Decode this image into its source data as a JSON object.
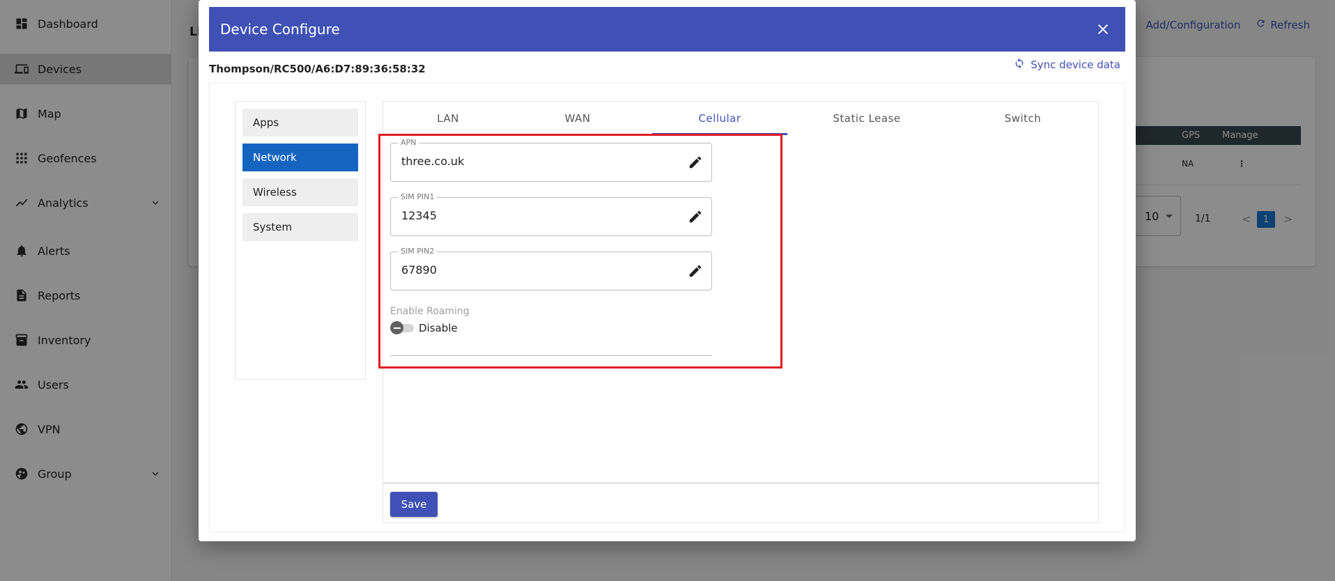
{
  "sidebar": {
    "items": [
      {
        "label": "Dashboard",
        "icon": "dashboard-icon"
      },
      {
        "label": "Devices",
        "icon": "devices-icon",
        "active": true
      },
      {
        "label": "Map",
        "icon": "map-icon"
      },
      {
        "label": "Geofences",
        "icon": "geofence-icon"
      },
      {
        "label": "Analytics",
        "icon": "analytics-icon",
        "expandable": true
      },
      {
        "label": "Alerts",
        "icon": "bell-icon"
      },
      {
        "label": "Reports",
        "icon": "report-icon"
      },
      {
        "label": "Inventory",
        "icon": "inventory-icon"
      },
      {
        "label": "Users",
        "icon": "users-icon"
      },
      {
        "label": "VPN",
        "icon": "vpn-globe-icon"
      },
      {
        "label": "Group",
        "icon": "group-icon",
        "expandable": true
      }
    ]
  },
  "background": {
    "title_fragment": "Li",
    "actions": {
      "add_config": "Add/Configuration",
      "refresh": "Refresh"
    },
    "table": {
      "headers": [
        "GPS",
        "Manage"
      ],
      "row": {
        "gps": "NA"
      }
    },
    "pager": {
      "rows_per_page": "10",
      "page_info": "1/1",
      "current_page": "1",
      "prev": "<",
      "next": ">"
    }
  },
  "dialog": {
    "title": "Device Configure",
    "device_id": "Thompson/RC500/A6:D7:89:36:58:32",
    "sync_label": "Sync device data",
    "menu": {
      "items": [
        {
          "label": "Apps"
        },
        {
          "label": "Network",
          "active": true
        },
        {
          "label": "Wireless"
        },
        {
          "label": "System"
        }
      ]
    },
    "tabs": [
      {
        "label": "LAN"
      },
      {
        "label": "WAN"
      },
      {
        "label": "Cellular",
        "active": true
      },
      {
        "label": "Static Lease"
      },
      {
        "label": "Switch"
      }
    ],
    "form": {
      "apn": {
        "label": "APN",
        "value": "three.co.uk"
      },
      "sim_pin1": {
        "label": "SIM PIN1",
        "value": "12345"
      },
      "sim_pin2": {
        "label": "SIM PIN2",
        "value": "67890"
      },
      "roaming": {
        "label": "Enable Roaming",
        "state_text": "Disable",
        "enabled": false
      }
    },
    "save_label": "Save"
  },
  "colors": {
    "primary": "#3f51b5",
    "menu_active": "#1565c0",
    "highlight": "#e01b24"
  }
}
